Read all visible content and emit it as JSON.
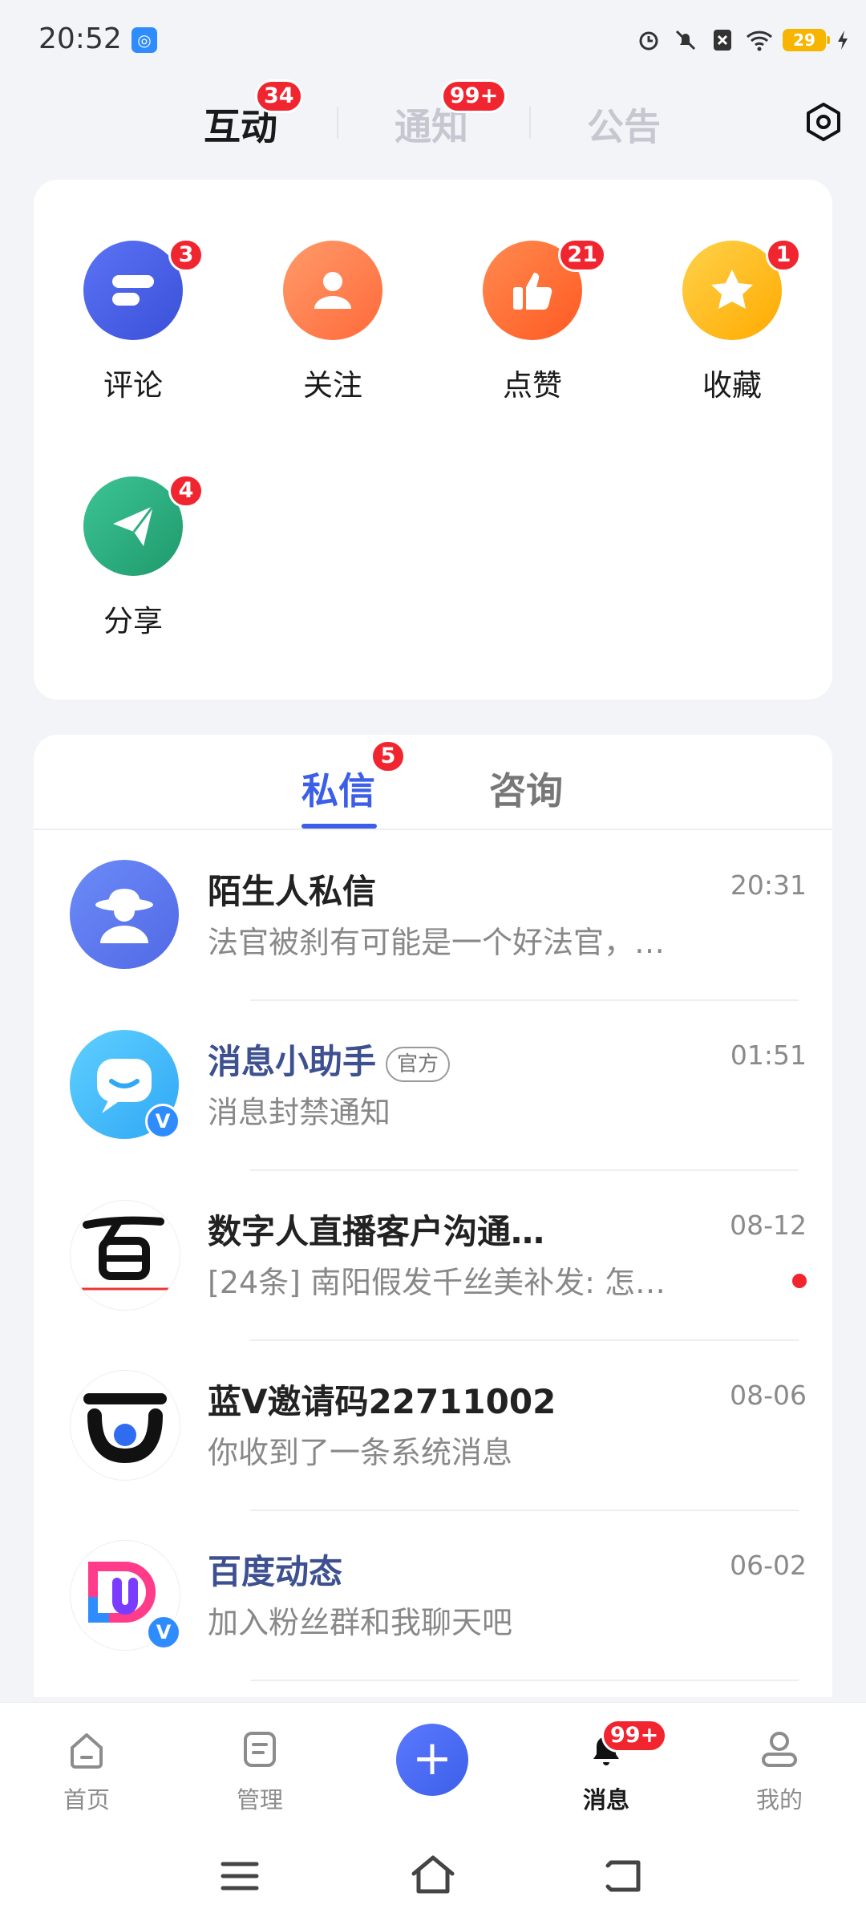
{
  "status_bar": {
    "time": "20:52",
    "battery": "29",
    "icons": [
      "app-notification-icon",
      "alarm-icon",
      "mute-icon",
      "sim-off-icon",
      "wifi-icon",
      "battery-icon",
      "charging-icon"
    ]
  },
  "top_tabs": [
    {
      "label": "互动",
      "badge": "34",
      "active": true
    },
    {
      "label": "通知",
      "badge": "99+",
      "active": false
    },
    {
      "label": "公告",
      "badge": "",
      "active": false
    }
  ],
  "interactions": [
    {
      "label": "评论",
      "badge": "3",
      "color": "#4a63e6"
    },
    {
      "label": "关注",
      "badge": "",
      "color": "#ff7a45"
    },
    {
      "label": "点赞",
      "badge": "21",
      "color": "#ff6a2c"
    },
    {
      "label": "收藏",
      "badge": "1",
      "color": "#ffb800"
    },
    {
      "label": "分享",
      "badge": "4",
      "color": "#2fae80"
    }
  ],
  "sub_tabs": [
    {
      "label": "私信",
      "badge": "5",
      "active": true
    },
    {
      "label": "咨询",
      "badge": "",
      "active": false
    }
  ],
  "messages": [
    {
      "name": "陌生人私信",
      "preview": "法官被刹有可能是一个好法官，…",
      "time": "20:31"
    },
    {
      "name": "消息小助手",
      "tag": "官方",
      "preview": "消息封禁通知",
      "time": "01:51"
    },
    {
      "name": "数字人直播客户沟通…",
      "preview": "[24条] 南阳假发千丝美补发: 怎…",
      "time": "08-12",
      "unread_dot": true
    },
    {
      "name": "蓝V邀请码22711002",
      "preview": "你收到了一条系统消息",
      "time": "08-06"
    },
    {
      "name": "百度动态",
      "preview": "加入粉丝群和我聊天吧",
      "time": "06-02"
    }
  ],
  "bottom_nav": [
    {
      "label": "首页",
      "icon": "home-icon"
    },
    {
      "label": "管理",
      "icon": "manage-icon"
    },
    {
      "label": "",
      "icon": "plus-icon"
    },
    {
      "label": "消息",
      "icon": "bell-icon",
      "badge": "99+",
      "active": true
    },
    {
      "label": "我的",
      "icon": "profile-icon"
    }
  ],
  "colors": {
    "accent": "#3d5fe8",
    "badge": "#f0252f"
  }
}
